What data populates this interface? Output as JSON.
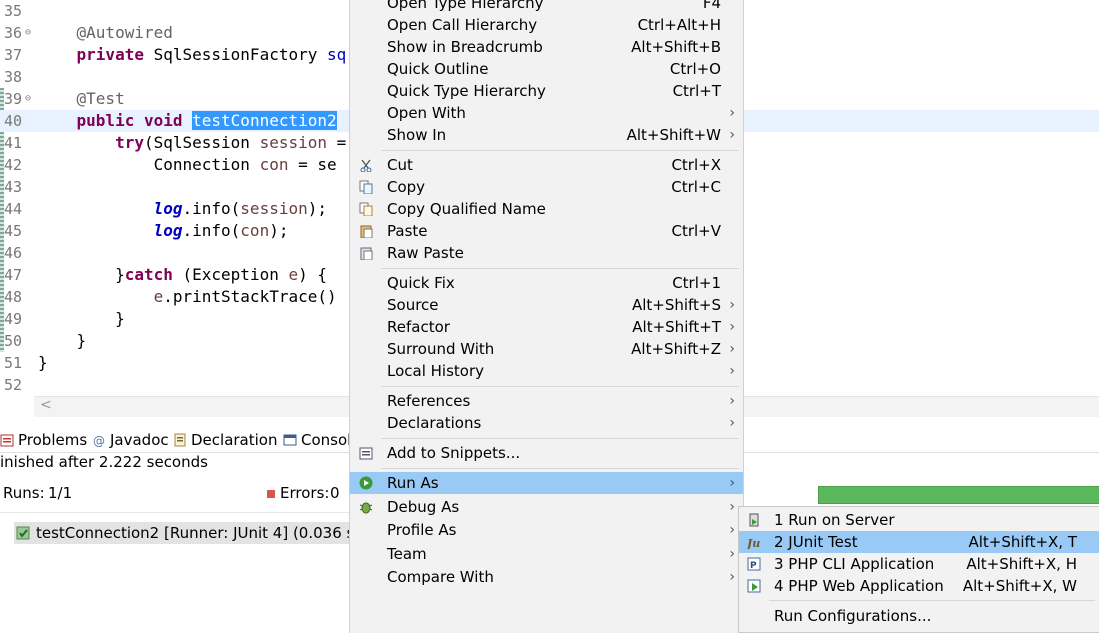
{
  "editor": {
    "lines": [
      {
        "num": "35",
        "html": ""
      },
      {
        "num": "36",
        "fold": true,
        "segments": [
          {
            "t": "    "
          },
          {
            "t": "@Autowired",
            "c": "ann"
          }
        ]
      },
      {
        "num": "37",
        "segments": [
          {
            "t": "    "
          },
          {
            "t": "private",
            "c": "kw"
          },
          {
            "t": " SqlSessionFactory "
          },
          {
            "t": "sq",
            "c": "fld2"
          }
        ]
      },
      {
        "num": "38",
        "segments": []
      },
      {
        "num": "39",
        "fold": true,
        "segments": [
          {
            "t": "    "
          },
          {
            "t": "@Test",
            "c": "ann"
          }
        ]
      },
      {
        "num": "40",
        "current": true,
        "segments": [
          {
            "t": "    "
          },
          {
            "t": "public",
            "c": "kw"
          },
          {
            "t": " "
          },
          {
            "t": "void",
            "c": "kw"
          },
          {
            "t": " "
          },
          {
            "t": "testConnection2",
            "c": "sel"
          }
        ]
      },
      {
        "num": "41",
        "segments": [
          {
            "t": "        "
          },
          {
            "t": "try",
            "c": "kw"
          },
          {
            "t": "(SqlSession "
          },
          {
            "t": "session",
            "c": "var"
          },
          {
            "t": " ="
          }
        ]
      },
      {
        "num": "42",
        "segments": [
          {
            "t": "            Connection "
          },
          {
            "t": "con",
            "c": "var"
          },
          {
            "t": " = se"
          }
        ]
      },
      {
        "num": "43",
        "segments": []
      },
      {
        "num": "44",
        "segments": [
          {
            "t": "            "
          },
          {
            "t": "log",
            "c": "fld"
          },
          {
            "t": ".info("
          },
          {
            "t": "session",
            "c": "var"
          },
          {
            "t": ");"
          }
        ]
      },
      {
        "num": "45",
        "segments": [
          {
            "t": "            "
          },
          {
            "t": "log",
            "c": "fld"
          },
          {
            "t": ".info("
          },
          {
            "t": "con",
            "c": "var"
          },
          {
            "t": ");"
          }
        ]
      },
      {
        "num": "46",
        "segments": []
      },
      {
        "num": "47",
        "segments": [
          {
            "t": "        }"
          },
          {
            "t": "catch",
            "c": "kw"
          },
          {
            "t": " (Exception "
          },
          {
            "t": "e",
            "c": "var"
          },
          {
            "t": ") {"
          }
        ]
      },
      {
        "num": "48",
        "segments": [
          {
            "t": "            "
          },
          {
            "t": "e",
            "c": "var"
          },
          {
            "t": ".printStackTrace()"
          }
        ]
      },
      {
        "num": "49",
        "segments": [
          {
            "t": "        }"
          }
        ]
      },
      {
        "num": "50",
        "segments": [
          {
            "t": "    }"
          }
        ]
      },
      {
        "num": "51",
        "segments": [
          {
            "t": "}"
          }
        ]
      },
      {
        "num": "52",
        "segments": []
      }
    ]
  },
  "views": {
    "tabs": [
      {
        "label": "Problems",
        "icon": "problems-icon"
      },
      {
        "label": "Javadoc",
        "icon": "javadoc-icon"
      },
      {
        "label": "Declaration",
        "icon": "declaration-icon"
      },
      {
        "label": "Console",
        "icon": "console-icon"
      }
    ],
    "finished": "inished after 2.222 seconds",
    "runs_label": "Runs:",
    "runs_value": "1/1",
    "errors_label": "Errors:",
    "errors_value": "0",
    "test_row": "testConnection2 [Runner: JUnit 4] (0.036 s)",
    "progress_color": "#5cb85c"
  },
  "context_menu": {
    "items": [
      {
        "label": "Open Type Hierarchy",
        "accel": "F4"
      },
      {
        "label": "Open Call Hierarchy",
        "accel": "Ctrl+Alt+H"
      },
      {
        "label": "Show in Breadcrumb",
        "accel": "Alt+Shift+B"
      },
      {
        "label": "Quick Outline",
        "accel": "Ctrl+O"
      },
      {
        "label": "Quick Type Hierarchy",
        "accel": "Ctrl+T"
      },
      {
        "label": "Open With",
        "submenu": true
      },
      {
        "label": "Show In",
        "accel": "Alt+Shift+W",
        "submenu": true
      },
      {
        "sep": true
      },
      {
        "label": "Cut",
        "accel": "Ctrl+X",
        "icon": "cut-icon"
      },
      {
        "label": "Copy",
        "accel": "Ctrl+C",
        "icon": "copy-icon"
      },
      {
        "label": "Copy Qualified Name",
        "icon": "copy-qualified-icon"
      },
      {
        "label": "Paste",
        "accel": "Ctrl+V",
        "icon": "paste-icon"
      },
      {
        "label": "Raw Paste",
        "icon": "raw-paste-icon"
      },
      {
        "sep": true
      },
      {
        "label": "Quick Fix",
        "accel": "Ctrl+1"
      },
      {
        "label": "Source",
        "accel": "Alt+Shift+S",
        "submenu": true
      },
      {
        "label": "Refactor",
        "accel": "Alt+Shift+T",
        "submenu": true
      },
      {
        "label": "Surround With",
        "accel": "Alt+Shift+Z",
        "submenu": true
      },
      {
        "label": "Local History",
        "submenu": true
      },
      {
        "sep": true
      },
      {
        "label": "References",
        "submenu": true
      },
      {
        "label": "Declarations",
        "submenu": true
      },
      {
        "sep": true
      },
      {
        "label": "Add to Snippets...",
        "icon": "snippets-icon"
      },
      {
        "sep": true
      },
      {
        "label": "Run As",
        "submenu": true,
        "icon": "run-icon",
        "highlight": true
      },
      {
        "label": "Debug As",
        "submenu": true,
        "icon": "debug-icon"
      },
      {
        "label": "Profile As",
        "submenu": true
      },
      {
        "label": "Team",
        "submenu": true
      },
      {
        "label": "Compare With",
        "submenu": true
      }
    ]
  },
  "run_as_submenu": {
    "items": [
      {
        "label": "1 Run on Server",
        "icon": "server-icon"
      },
      {
        "label": "2 JUnit Test",
        "accel": "Alt+Shift+X, T",
        "icon": "junit-icon",
        "highlight": true
      },
      {
        "label": "3 PHP CLI Application",
        "accel": "Alt+Shift+X, H",
        "icon": "php-cli-icon"
      },
      {
        "label": "4 PHP Web Application",
        "accel": "Alt+Shift+X, W",
        "icon": "php-web-icon"
      },
      {
        "sep": true
      },
      {
        "label": "Run Configurations..."
      }
    ]
  }
}
